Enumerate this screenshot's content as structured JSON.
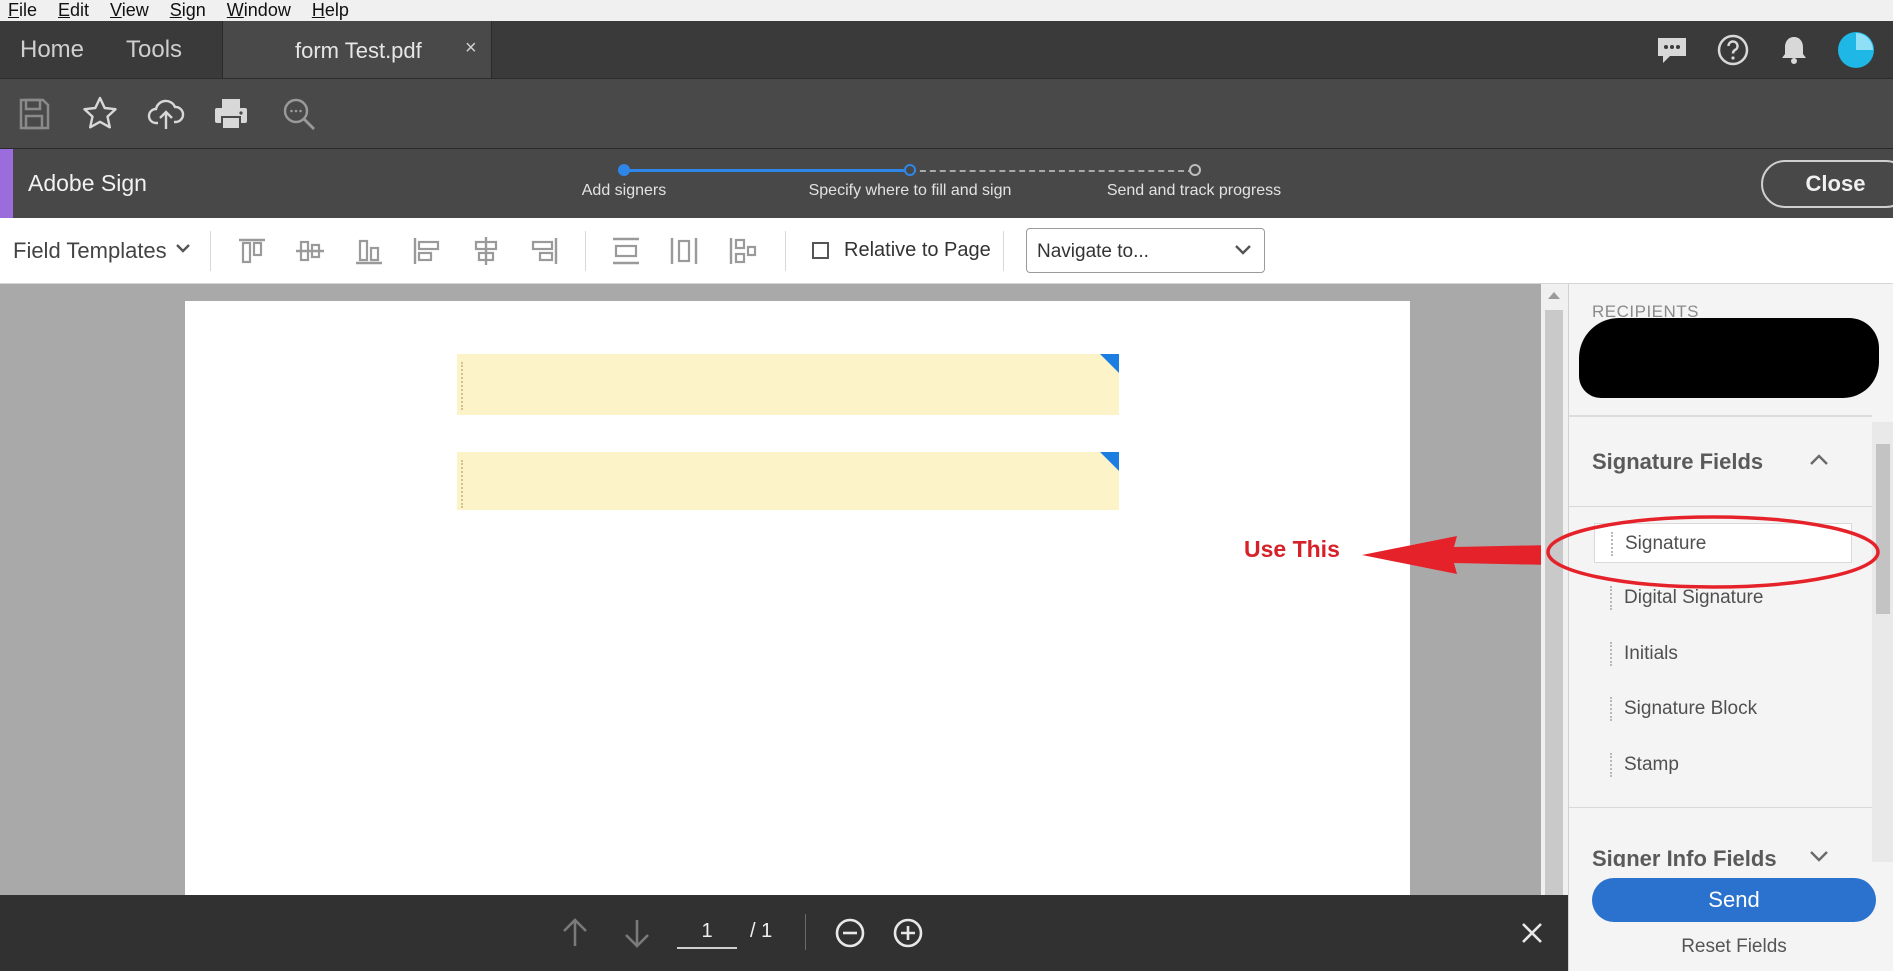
{
  "menubar": {
    "items": [
      {
        "underline": "F",
        "rest": "ile"
      },
      {
        "underline": "E",
        "rest": "dit"
      },
      {
        "underline": "V",
        "rest": "iew"
      },
      {
        "underline": "S",
        "rest": "ign"
      },
      {
        "underline": "W",
        "rest": "indow"
      },
      {
        "underline": "H",
        "rest": "elp"
      }
    ]
  },
  "tabs": {
    "home": "Home",
    "tools": "Tools",
    "document": "form Test.pdf",
    "document_close": "×"
  },
  "header_icons": [
    "chat-icon",
    "help-icon",
    "bell-icon",
    "avatar"
  ],
  "toolbar_icons": [
    "save-icon",
    "star-icon",
    "cloud-upload-icon",
    "print-icon",
    "zoom-search-icon"
  ],
  "sign_bar": {
    "title": "Adobe Sign",
    "steps": [
      "Add signers",
      "Specify where to fill and sign",
      "Send and track progress"
    ],
    "close_label": "Close",
    "accent_color": "#9b6ddc",
    "progress_color": "#2e86e8"
  },
  "field_bar": {
    "templates_label": "Field Templates",
    "relative_label": "Relative to Page",
    "relative_checked": false,
    "navigate_value": "Navigate to..."
  },
  "document": {
    "field_color": "#fdf3c9",
    "marker_color": "#1b7ee0",
    "annotation_text": "Use This",
    "annotation_color": "#d62128"
  },
  "page_nav": {
    "current_page": "1",
    "total": "/ 1"
  },
  "panel": {
    "recipients_label": "RECIPIENTS",
    "signature_fields_title": "Signature Fields",
    "signature_fields": [
      "Signature",
      "Digital Signature",
      "Initials",
      "Signature Block",
      "Stamp"
    ],
    "signer_info_title": "Signer Info Fields",
    "send_label": "Send",
    "reset_label": "Reset Fields",
    "send_color": "#2a72cd"
  }
}
